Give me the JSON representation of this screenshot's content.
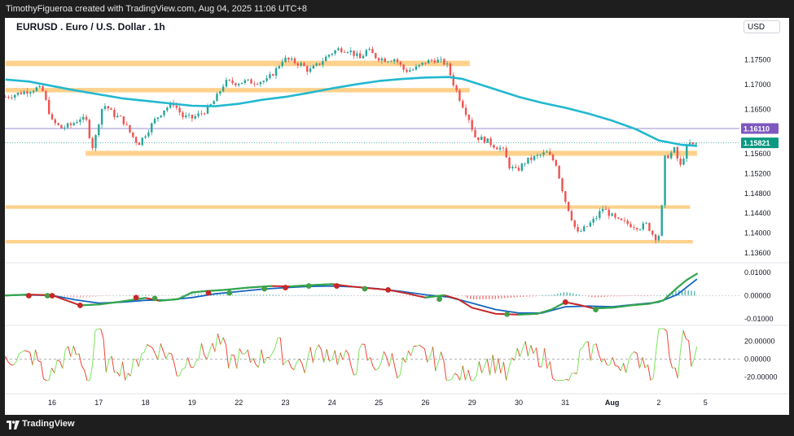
{
  "header": {
    "credit": "TimothyFigueroa created with TradingView.com, Aug 04, 2025 11:06 UTC+8"
  },
  "footer": {
    "brand": "TradingView"
  },
  "colors": {
    "up": "#26a69a",
    "down": "#ef5350",
    "ma": "#22b8cf",
    "zone": "#ffcc80",
    "purple": "#9c8cd0",
    "cyan_dot": "#26a69a",
    "macd_green": "#2fa84f",
    "macd_red": "#c62828",
    "macd_blue": "#1565c0",
    "osc_green": "#7ee35c",
    "osc_red": "#f44336"
  },
  "chart_data": [
    {
      "type": "candlestick",
      "title": "EURUSD . Euro / U.S. Dollar . 1h",
      "currency": "USD",
      "ylim": [
        1.1345,
        1.1795
      ],
      "x_ticks": [
        "16",
        "17",
        "18",
        "19",
        "22",
        "23",
        "24",
        "25",
        "26",
        "29",
        "30",
        "31",
        "Aug",
        "2",
        "5"
      ],
      "y_ticks": [
        "1.17500",
        "1.17000",
        "1.16500",
        "1.15600",
        "1.15200",
        "1.14800",
        "1.14400",
        "1.14000",
        "1.13600"
      ],
      "price_labels": [
        {
          "text": "1.16110",
          "value": 1.1611,
          "style": "purple"
        },
        {
          "text": "1.15821",
          "value": 1.15821,
          "style": "green"
        }
      ],
      "horizontal_line": {
        "value": 1.1611
      },
      "last_price_line": {
        "value": 1.15821
      },
      "zones": [
        {
          "from_day": -1.0,
          "to_day": 8.95,
          "y1": 1.1737,
          "y2": 1.1748
        },
        {
          "from_day": -1.0,
          "to_day": 8.95,
          "y1": 1.1684,
          "y2": 1.1693
        },
        {
          "from_day": 0.72,
          "to_day": 13.82,
          "y1": 1.1556,
          "y2": 1.1566
        },
        {
          "from_day": -1.0,
          "to_day": 13.67,
          "y1": 1.1449,
          "y2": 1.1456
        },
        {
          "from_day": -1.0,
          "to_day": 13.73,
          "y1": 1.1379,
          "y2": 1.1386
        }
      ],
      "price_path": [
        [
          -1.0,
          1.1675
        ],
        [
          -0.8,
          1.168
        ],
        [
          -0.5,
          1.1688
        ],
        [
          -0.3,
          1.1693
        ],
        [
          -0.2,
          1.1686
        ],
        [
          0.0,
          1.1625
        ],
        [
          0.2,
          1.1612
        ],
        [
          0.4,
          1.1618
        ],
        [
          0.6,
          1.1632
        ],
        [
          0.75,
          1.1625
        ],
        [
          0.85,
          1.157
        ],
        [
          0.95,
          1.16
        ],
        [
          1.05,
          1.165
        ],
        [
          1.15,
          1.1658
        ],
        [
          1.3,
          1.164
        ],
        [
          1.5,
          1.163
        ],
        [
          1.7,
          1.1598
        ],
        [
          1.85,
          1.158
        ],
        [
          2.0,
          1.16
        ],
        [
          2.2,
          1.1628
        ],
        [
          2.4,
          1.165
        ],
        [
          2.6,
          1.1662
        ],
        [
          2.8,
          1.1635
        ],
        [
          3.0,
          1.1632
        ],
        [
          3.2,
          1.1642
        ],
        [
          3.35,
          1.1652
        ],
        [
          3.5,
          1.167
        ],
        [
          3.7,
          1.1705
        ],
        [
          3.95,
          1.1703
        ],
        [
          4.1,
          1.1706
        ],
        [
          4.3,
          1.1705
        ],
        [
          4.6,
          1.1708
        ],
        [
          4.8,
          1.173
        ],
        [
          4.95,
          1.1752
        ],
        [
          5.1,
          1.1748
        ],
        [
          5.35,
          1.174
        ],
        [
          5.5,
          1.1727
        ],
        [
          5.7,
          1.174
        ],
        [
          5.95,
          1.1762
        ],
        [
          6.15,
          1.1772
        ],
        [
          6.35,
          1.177
        ],
        [
          6.6,
          1.1752
        ],
        [
          6.75,
          1.177
        ],
        [
          6.95,
          1.1755
        ],
        [
          7.15,
          1.175
        ],
        [
          7.35,
          1.1752
        ],
        [
          7.55,
          1.1728
        ],
        [
          7.75,
          1.173
        ],
        [
          8.0,
          1.1745
        ],
        [
          8.2,
          1.175
        ],
        [
          8.45,
          1.1742
        ],
        [
          8.6,
          1.1702
        ],
        [
          8.75,
          1.1668
        ],
        [
          8.95,
          1.1628
        ],
        [
          9.05,
          1.1595
        ],
        [
          9.3,
          1.1587
        ],
        [
          9.5,
          1.1575
        ],
        [
          9.65,
          1.157
        ],
        [
          9.8,
          1.1535
        ],
        [
          9.95,
          1.1525
        ],
        [
          10.15,
          1.1545
        ],
        [
          10.4,
          1.1555
        ],
        [
          10.6,
          1.1562
        ],
        [
          10.8,
          1.154
        ],
        [
          10.9,
          1.15
        ],
        [
          11.0,
          1.1465
        ],
        [
          11.1,
          1.144
        ],
        [
          11.25,
          1.1398
        ],
        [
          11.45,
          1.1412
        ],
        [
          11.65,
          1.143
        ],
        [
          11.8,
          1.145
        ],
        [
          11.95,
          1.1438
        ],
        [
          12.1,
          1.1425
        ],
        [
          12.3,
          1.142
        ],
        [
          12.45,
          1.1415
        ],
        [
          12.6,
          1.1412
        ],
        [
          12.75,
          1.1418
        ],
        [
          12.85,
          1.14
        ],
        [
          12.95,
          1.139
        ],
        [
          13.03,
          1.14
        ],
        [
          13.08,
          1.147
        ],
        [
          13.12,
          1.155
        ],
        [
          13.25,
          1.156
        ],
        [
          13.35,
          1.157
        ],
        [
          13.45,
          1.153
        ],
        [
          13.55,
          1.156
        ],
        [
          13.65,
          1.1582
        ],
        [
          13.75,
          1.1575
        ],
        [
          13.82,
          1.1582
        ]
      ],
      "ma_path": [
        [
          -1.0,
          1.171
        ],
        [
          -0.5,
          1.1706
        ],
        [
          0.0,
          1.1697
        ],
        [
          0.5,
          1.1688
        ],
        [
          1.0,
          1.168
        ],
        [
          1.5,
          1.1672
        ],
        [
          2.0,
          1.1667
        ],
        [
          2.5,
          1.1662
        ],
        [
          3.0,
          1.1657
        ],
        [
          3.5,
          1.1656
        ],
        [
          4.0,
          1.1661
        ],
        [
          4.5,
          1.1669
        ],
        [
          5.0,
          1.1675
        ],
        [
          5.5,
          1.1683
        ],
        [
          6.0,
          1.1692
        ],
        [
          6.5,
          1.17
        ],
        [
          7.0,
          1.1707
        ],
        [
          7.5,
          1.1711
        ],
        [
          8.0,
          1.1714
        ],
        [
          8.5,
          1.1715
        ],
        [
          8.8,
          1.1711
        ],
        [
          9.0,
          1.1705
        ],
        [
          9.5,
          1.169
        ],
        [
          10.0,
          1.1675
        ],
        [
          10.5,
          1.1663
        ],
        [
          11.0,
          1.1653
        ],
        [
          11.5,
          1.1641
        ],
        [
          12.0,
          1.1627
        ],
        [
          12.5,
          1.161
        ],
        [
          13.0,
          1.1587
        ],
        [
          13.5,
          1.1578
        ],
        [
          13.82,
          1.1576
        ]
      ]
    },
    {
      "type": "line",
      "name": "macd-panel",
      "ylim": [
        -0.0125,
        0.0125
      ],
      "y_ticks": [
        "0.01000",
        "0.00000",
        "-0.01000"
      ],
      "fast_path": [
        [
          -1.0,
          0.0001
        ],
        [
          -0.5,
          0.0005
        ],
        [
          0.0,
          0.0002
        ],
        [
          0.3,
          -0.002
        ],
        [
          0.6,
          -0.0042
        ],
        [
          1.0,
          -0.0038
        ],
        [
          1.5,
          -0.0025
        ],
        [
          2.0,
          -0.001
        ],
        [
          2.3,
          -0.0022
        ],
        [
          2.7,
          -0.0015
        ],
        [
          3.0,
          0.0014
        ],
        [
          3.3,
          0.002
        ],
        [
          3.7,
          0.0025
        ],
        [
          4.2,
          0.0035
        ],
        [
          4.7,
          0.0042
        ],
        [
          5.1,
          0.004
        ],
        [
          5.5,
          0.0045
        ],
        [
          6.0,
          0.005
        ],
        [
          6.4,
          0.004
        ],
        [
          6.8,
          0.0032
        ],
        [
          7.2,
          0.0025
        ],
        [
          7.6,
          0.001
        ],
        [
          8.0,
          -0.0008
        ],
        [
          8.4,
          0.0002
        ],
        [
          8.7,
          -0.0015
        ],
        [
          9.0,
          -0.0052
        ],
        [
          9.5,
          -0.0078
        ],
        [
          10.0,
          -0.0082
        ],
        [
          10.4,
          -0.0078
        ],
        [
          10.7,
          -0.006
        ],
        [
          11.0,
          -0.0028
        ],
        [
          11.3,
          -0.004
        ],
        [
          11.6,
          -0.0055
        ],
        [
          12.0,
          -0.0052
        ],
        [
          12.4,
          -0.0042
        ],
        [
          12.8,
          -0.0035
        ],
        [
          13.1,
          -0.002
        ],
        [
          13.4,
          0.0035
        ],
        [
          13.6,
          0.0068
        ],
        [
          13.82,
          0.0095
        ]
      ],
      "slow_path": [
        [
          -1.0,
          0.0002
        ],
        [
          -0.5,
          0.0003
        ],
        [
          0.0,
          0.0001
        ],
        [
          0.5,
          -0.0018
        ],
        [
          1.0,
          -0.0032
        ],
        [
          1.5,
          -0.0028
        ],
        [
          2.0,
          -0.002
        ],
        [
          2.5,
          -0.0018
        ],
        [
          3.0,
          -0.0008
        ],
        [
          3.5,
          0.0008
        ],
        [
          4.0,
          0.0018
        ],
        [
          4.5,
          0.0028
        ],
        [
          5.0,
          0.0035
        ],
        [
          5.5,
          0.004
        ],
        [
          6.0,
          0.0042
        ],
        [
          6.5,
          0.0038
        ],
        [
          7.0,
          0.003
        ],
        [
          7.5,
          0.0018
        ],
        [
          8.0,
          0.0004
        ],
        [
          8.5,
          -0.0006
        ],
        [
          9.0,
          -0.0032
        ],
        [
          9.5,
          -0.006
        ],
        [
          10.0,
          -0.0075
        ],
        [
          10.5,
          -0.0075
        ],
        [
          11.0,
          -0.0048
        ],
        [
          11.5,
          -0.0045
        ],
        [
          12.0,
          -0.0048
        ],
        [
          12.5,
          -0.0038
        ],
        [
          13.0,
          -0.0028
        ],
        [
          13.4,
          0.0005
        ],
        [
          13.82,
          0.0072
        ]
      ],
      "dots": [
        [
          -0.5,
          0.0,
          "red"
        ],
        [
          -0.1,
          0.0,
          "green"
        ],
        [
          0.0,
          0.0,
          "red"
        ],
        [
          0.6,
          -0.0042,
          "red"
        ],
        [
          1.8,
          -0.0008,
          "red"
        ],
        [
          2.2,
          -0.0012,
          "green"
        ],
        [
          3.35,
          0.0012,
          "red"
        ],
        [
          3.8,
          0.0012,
          "green"
        ],
        [
          4.55,
          0.003,
          "green"
        ],
        [
          5.0,
          0.0035,
          "red"
        ],
        [
          5.5,
          0.0042,
          "green"
        ],
        [
          6.1,
          0.0042,
          "red"
        ],
        [
          6.7,
          0.003,
          "green"
        ],
        [
          7.2,
          0.0025,
          "red"
        ],
        [
          8.3,
          -0.0015,
          "green"
        ],
        [
          9.75,
          -0.008,
          "green"
        ],
        [
          11.0,
          -0.0028,
          "red"
        ],
        [
          11.65,
          -0.006,
          "green"
        ]
      ],
      "hist_from": 8.9,
      "hist_to": 13.82
    },
    {
      "type": "line",
      "name": "oscillator-panel",
      "ylim": [
        -28,
        36
      ],
      "y_ticks": [
        "20.00000",
        "0.00000",
        "-20.00000"
      ]
    }
  ]
}
